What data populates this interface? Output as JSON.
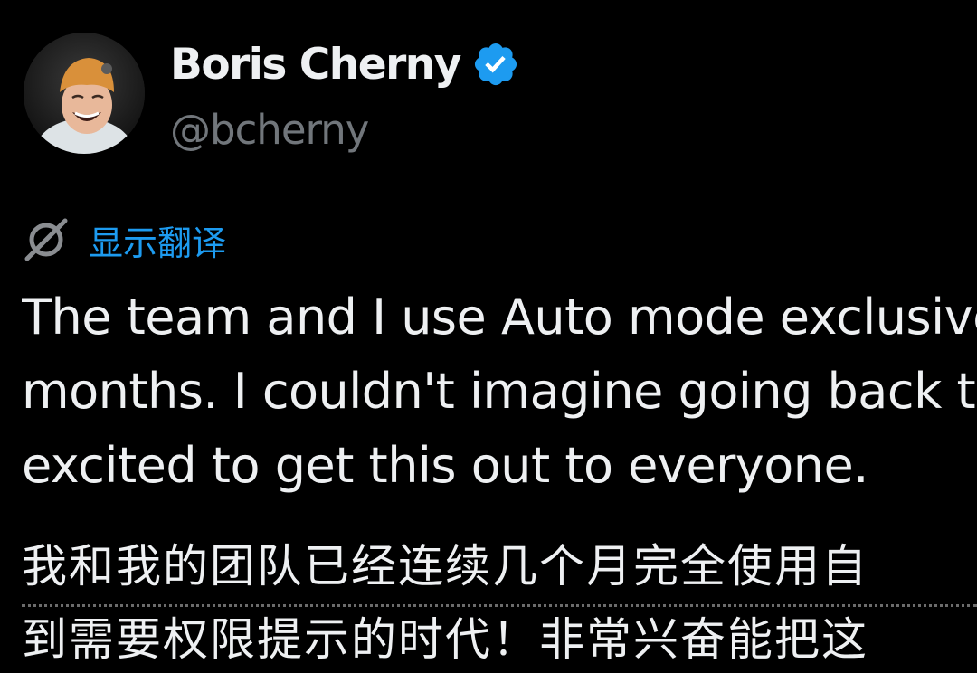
{
  "author": {
    "display_name": "Boris Cherny",
    "handle": "@bcherny",
    "verified_icon": "verified-badge-icon",
    "verified_color": "#1d9bf0"
  },
  "translate": {
    "icon": "translate-toggle-icon",
    "label": "显示翻译",
    "color": "#1d9bf0"
  },
  "tweet": {
    "lines": [
      "The team and I use Auto mode exclusive",
      "months. I couldn't imagine going back to",
      "excited to get this out to everyone."
    ]
  },
  "translation": {
    "lines": [
      "我和我的团队已经连续几个月完全使用自",
      "到需要权限提示的时代！非常兴奋能把这"
    ]
  }
}
